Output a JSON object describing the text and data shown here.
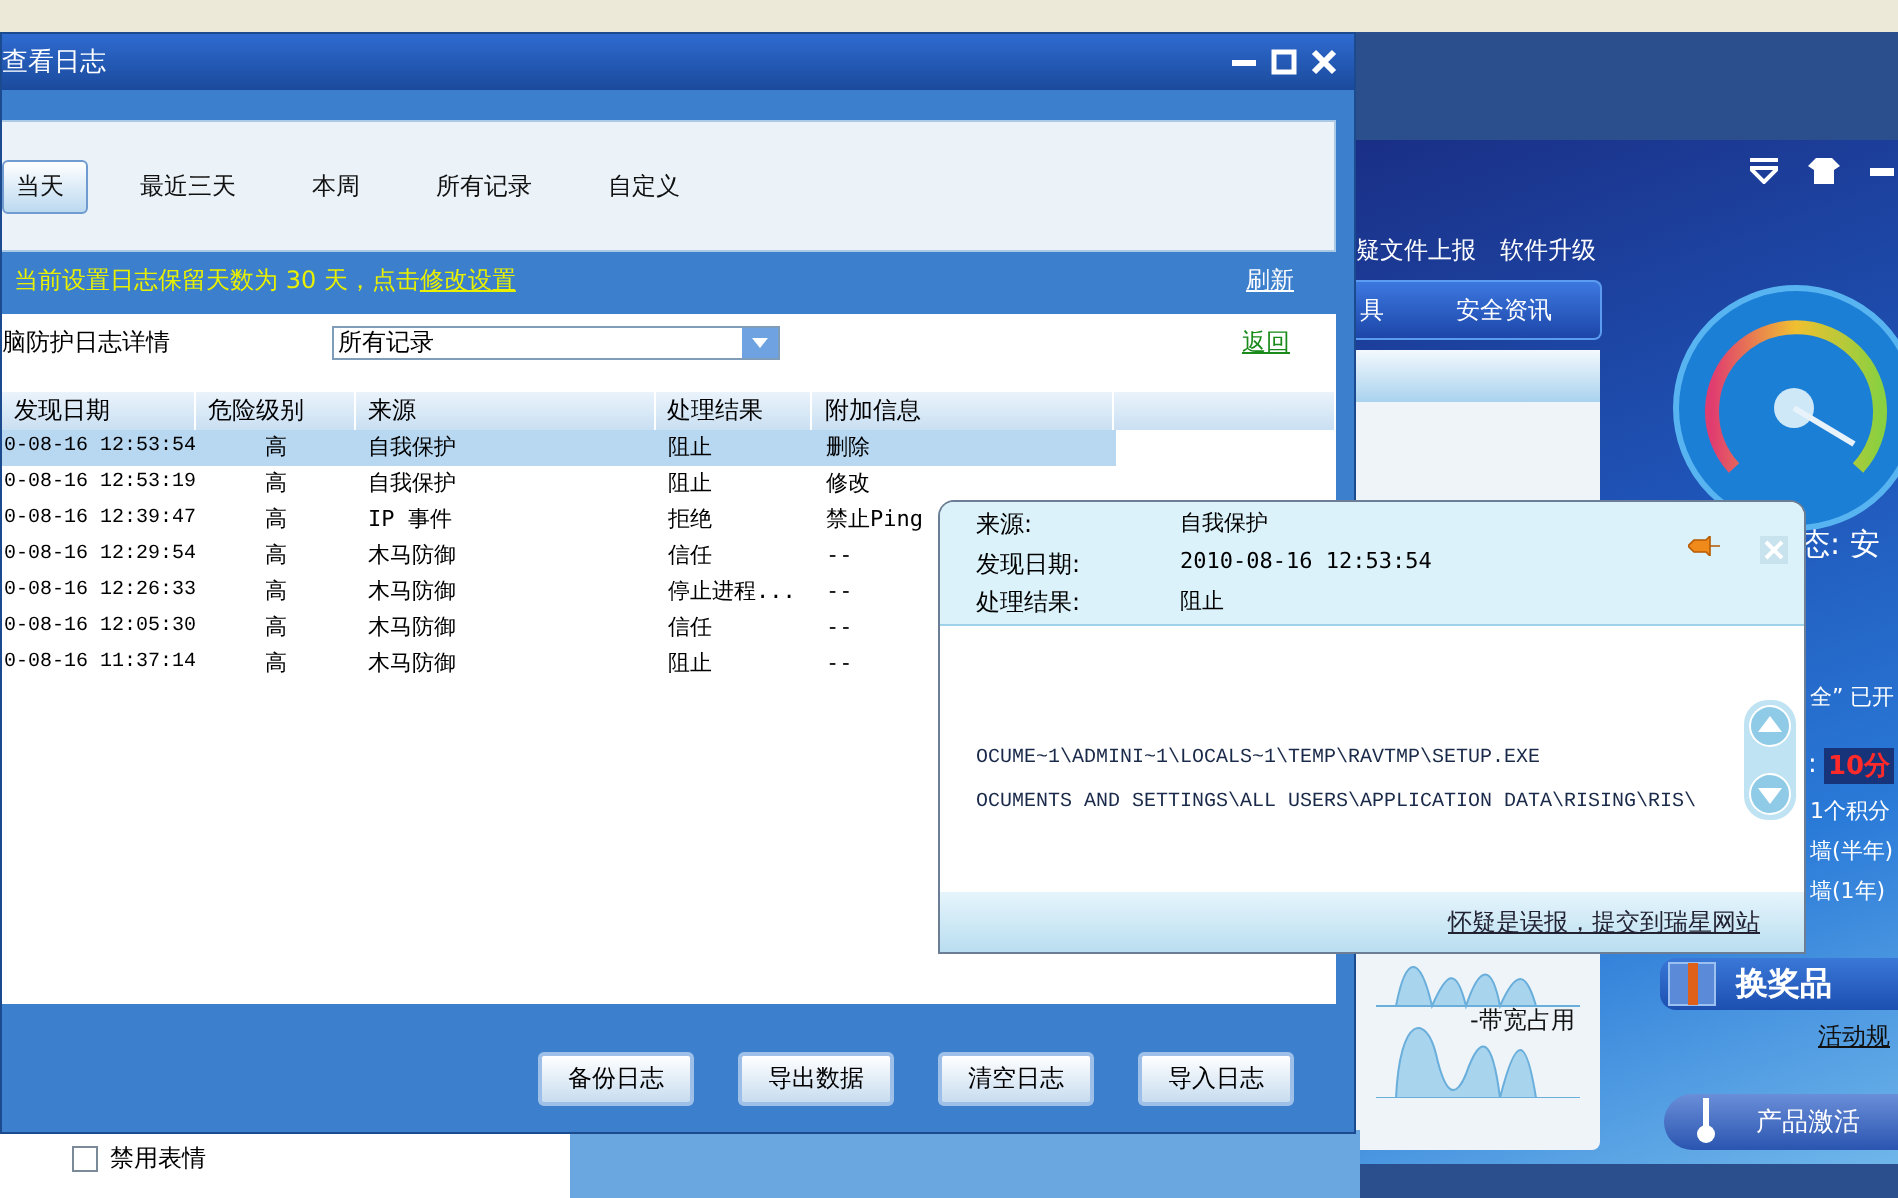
{
  "main_window": {
    "title": "查看日志",
    "tabs": [
      {
        "label": "当天",
        "selected": true
      },
      {
        "label": "最近三天",
        "selected": false
      },
      {
        "label": "本周",
        "selected": false
      },
      {
        "label": "所有记录",
        "selected": false
      },
      {
        "label": "自定义",
        "selected": false
      }
    ],
    "notice": {
      "text": "当前设置日志保留天数为 30 天，点击",
      "link": "修改设置"
    },
    "refresh": "刷新",
    "detail_label": "脑防护日志详情",
    "filter": {
      "value": "所有记录"
    },
    "back": "返回",
    "table": {
      "columns": [
        "发现日期",
        "危险级别",
        "来源",
        "处理结果",
        "附加信息"
      ],
      "rows": [
        {
          "cells": [
            "0-08-16 12:53:54",
            "高",
            "自我保护",
            "阻止",
            "删除"
          ],
          "selected": true
        },
        {
          "cells": [
            "0-08-16 12:53:19",
            "高",
            "自我保护",
            "阻止",
            "修改"
          ],
          "selected": false
        },
        {
          "cells": [
            "0-08-16 12:39:47",
            "高",
            "IP 事件",
            "拒绝",
            "禁止Ping"
          ],
          "selected": false
        },
        {
          "cells": [
            "0-08-16 12:29:54",
            "高",
            "木马防御",
            "信任",
            "--"
          ],
          "selected": false
        },
        {
          "cells": [
            "0-08-16 12:26:33",
            "高",
            "木马防御",
            "停止进程...",
            "--"
          ],
          "selected": false
        },
        {
          "cells": [
            "0-08-16 12:05:30",
            "高",
            "木马防御",
            "信任",
            "--"
          ],
          "selected": false
        },
        {
          "cells": [
            "0-08-16 11:37:14",
            "高",
            "木马防御",
            "阻止",
            "--"
          ],
          "selected": false
        }
      ]
    },
    "buttons": [
      "备份日志",
      "导出数据",
      "清空日志",
      "导入日志"
    ]
  },
  "popup": {
    "fields": [
      {
        "label": "来源:",
        "value": "自我保护"
      },
      {
        "label": "发现日期:",
        "value": "2010-08-16 12:53:54"
      },
      {
        "label": "处理结果:",
        "value": "阻止"
      }
    ],
    "paths": [
      "OCUME~1\\ADMINI~1\\LOCALS~1\\TEMP\\RAVTMP\\SETUP.EXE",
      "OCUMENTS AND SETTINGS\\ALL USERS\\APPLICATION DATA\\RISING\\RIS\\"
    ],
    "link": "怀疑是误报，提交到瑞星网站"
  },
  "background_app": {
    "menu": [
      "疑文件上报",
      "软件升级"
    ],
    "nav": [
      "具",
      "安全资讯"
    ],
    "status": "态: 安",
    "enabled": "全” 已开",
    "score": {
      "label": ":",
      "value": "10分"
    },
    "lines": [
      "1个积分",
      "墙(半年)",
      "墙(1年)"
    ],
    "prize_button": "换奖品",
    "rules_link": "活动规",
    "bandwidth_label": "-带宽占用",
    "activate_button": "产品激活"
  },
  "chat_panel": {
    "option": {
      "label": "禁用表情",
      "checked": false
    }
  }
}
